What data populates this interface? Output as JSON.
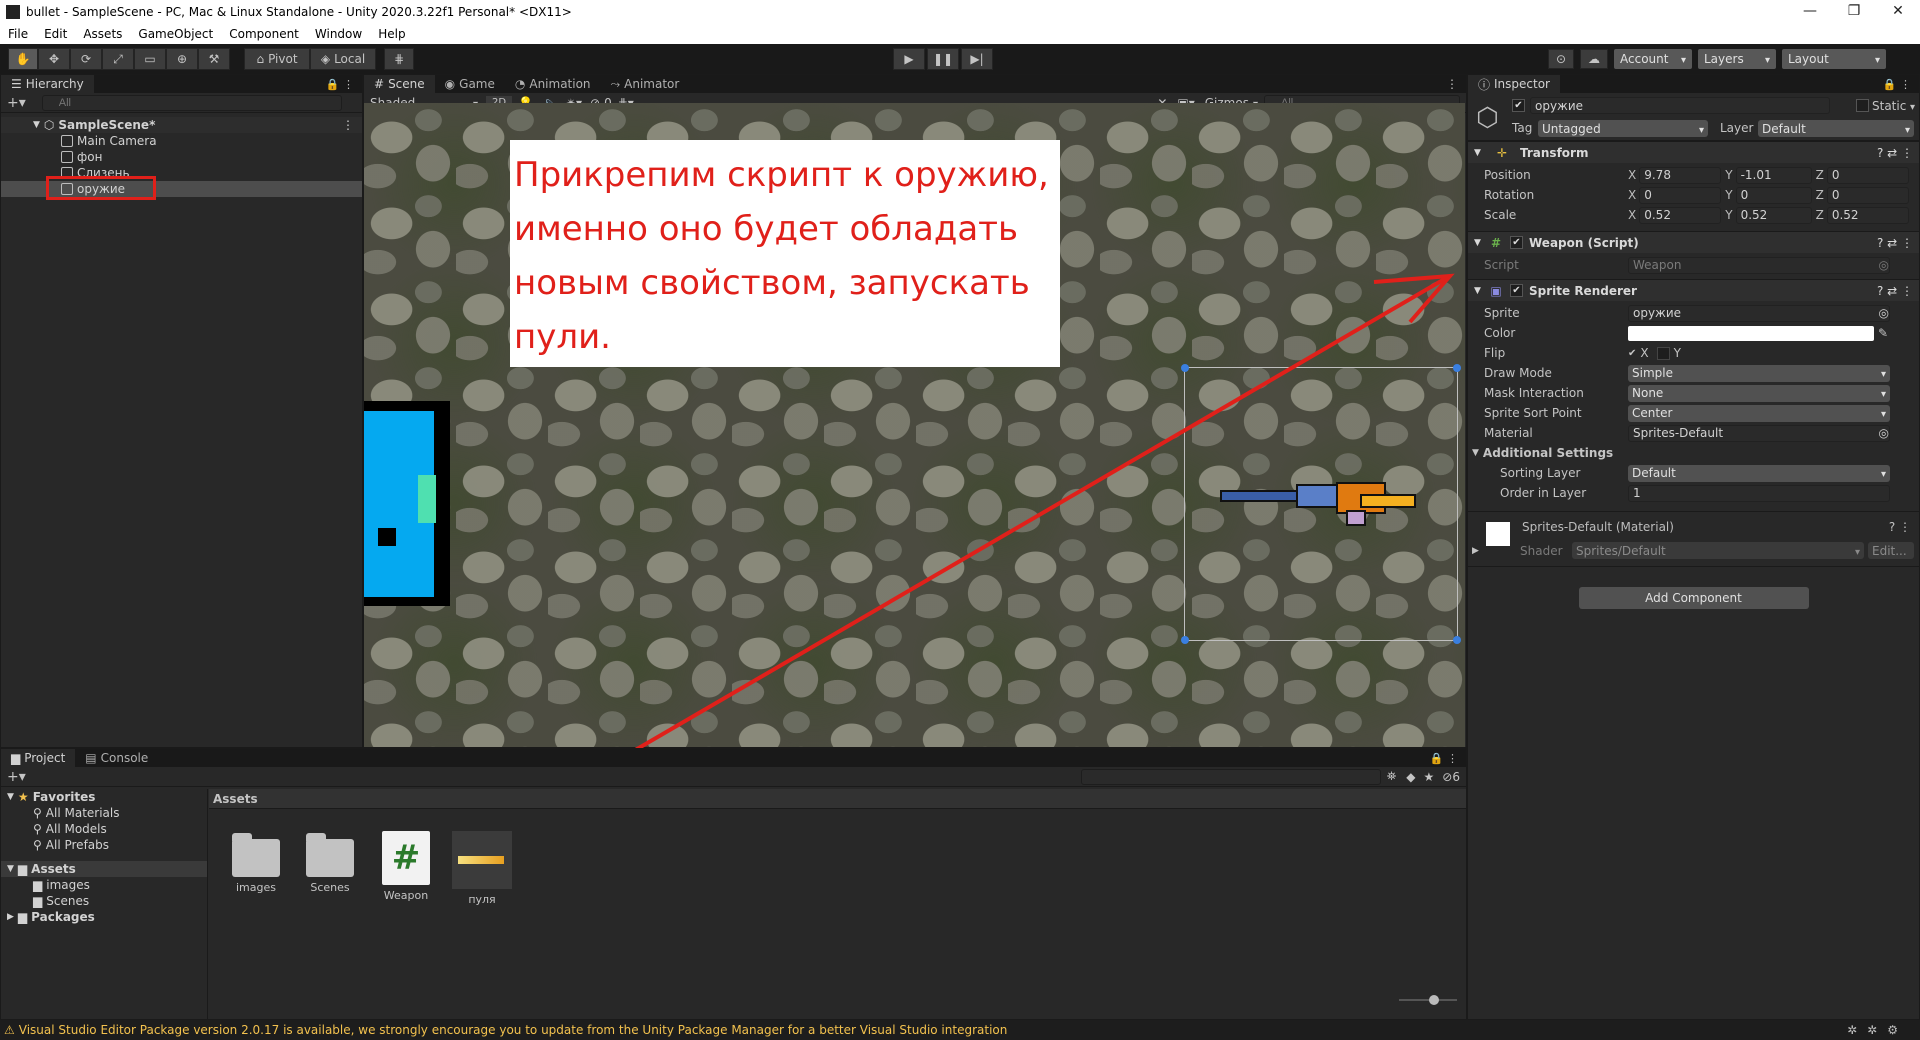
{
  "window": {
    "title": "bullet - SampleScene - PC, Mac & Linux Standalone - Unity 2020.3.22f1 Personal* <DX11>",
    "controls": [
      "—",
      "❐",
      "✕"
    ]
  },
  "menu": [
    "File",
    "Edit",
    "Assets",
    "GameObject",
    "Component",
    "Window",
    "Help"
  ],
  "toolbar": {
    "pivot": "Pivot",
    "local": "Local",
    "account": "Account",
    "layers": "Layers",
    "layout": "Layout"
  },
  "hierarchy": {
    "tab": "Hierarchy",
    "search_placeholder": "All",
    "scene": "SampleScene*",
    "items": [
      "Main Camera",
      "фон",
      "Слизень",
      "оружие"
    ]
  },
  "scene_tabs": [
    "Scene",
    "Game",
    "Animation",
    "Animator"
  ],
  "scene_bar": {
    "shading": "Shaded",
    "mode2d": "2D",
    "hidden_count": "0",
    "gizmos": "Gizmos",
    "search_placeholder": "All"
  },
  "annotation": {
    "text": "Прикрепим скрипт к оружию, именно оно будет обладать новым свойством, запускать пули."
  },
  "inspector": {
    "tab": "Inspector",
    "object_name": "оружие",
    "static": "Static",
    "tag_label": "Tag",
    "tag": "Untagged",
    "layer_label": "Layer",
    "layer": "Default",
    "transform": {
      "title": "Transform",
      "rows": [
        {
          "label": "Position",
          "x": "9.78",
          "y": "-1.01",
          "z": "0"
        },
        {
          "label": "Rotation",
          "x": "0",
          "y": "0",
          "z": "0"
        },
        {
          "label": "Scale",
          "x": "0.52",
          "y": "0.52",
          "z": "0.52"
        }
      ]
    },
    "weapon": {
      "title": "Weapon (Script)",
      "script_label": "Script",
      "script_value": "Weapon"
    },
    "sprite_renderer": {
      "title": "Sprite Renderer",
      "sprite_label": "Sprite",
      "sprite": "оружие",
      "color_label": "Color",
      "flip_label": "Flip",
      "flip_x": "X",
      "flip_y": "Y",
      "draw_mode_label": "Draw Mode",
      "draw_mode": "Simple",
      "mask_label": "Mask Interaction",
      "mask": "None",
      "sort_point_label": "Sprite Sort Point",
      "sort_point": "Center",
      "material_label": "Material",
      "material": "Sprites-Default",
      "additional": "Additional Settings",
      "sorting_layer_label": "Sorting Layer",
      "sorting_layer": "Default",
      "order_label": "Order in Layer",
      "order": "1"
    },
    "material": {
      "title": "Sprites-Default (Material)",
      "shader_label": "Shader",
      "shader": "Sprites/Default",
      "edit": "Edit..."
    },
    "add_component": "Add Component"
  },
  "project": {
    "tabs": [
      "Project",
      "Console"
    ],
    "favorites": {
      "label": "Favorites",
      "items": [
        "All Materials",
        "All Models",
        "All Prefabs"
      ]
    },
    "assets_root": "Assets",
    "asset_folders": [
      "images",
      "Scenes"
    ],
    "packages": "Packages",
    "breadcrumb": "Assets",
    "hidden_count": "6",
    "assets": [
      {
        "name": "images"
      },
      {
        "name": "Scenes"
      },
      {
        "name": "Weapon"
      },
      {
        "name": "пуля"
      }
    ]
  },
  "status": "Visual Studio Editor Package version 2.0.17 is available, we strongly encourage you to update from the Unity Package Manager for a better Visual Studio integration",
  "colors": {
    "accent_red": "#e0201a",
    "selection": "#2c5d87",
    "scene_bg": "#4b4b40",
    "slime": "#05a9f0"
  }
}
